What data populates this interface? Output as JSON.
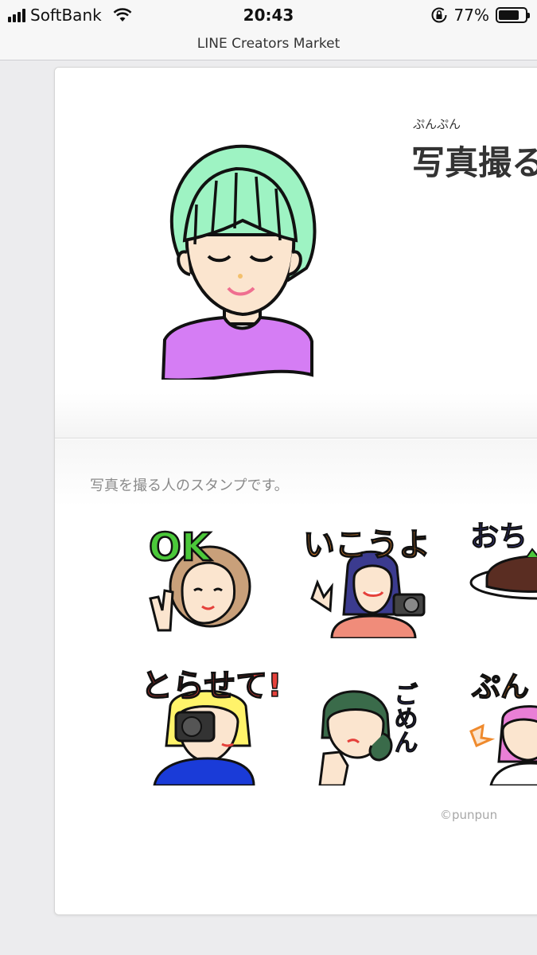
{
  "status_bar": {
    "carrier": "SoftBank",
    "time": "20:43",
    "battery_percent": "77%",
    "battery_level": 0.77
  },
  "browser": {
    "page_title": "LINE Creators Market"
  },
  "product": {
    "author": "ぷんぷん",
    "title": "写真撮る",
    "description": "写真を撮る人のスタンプです。",
    "copyright": "©punpun"
  },
  "stickers": {
    "s1": "OK",
    "s2": "いこうよ",
    "s3": "おち",
    "s4": "とらせて!",
    "s5": "ごめん",
    "s6": "ぷん"
  },
  "colors": {
    "hair_mint": "#9ef3c3",
    "shirt_purple": "#d57df4",
    "skin": "#fbe5cf",
    "text_orange": "#ef8a2d",
    "text_red": "#e5413b",
    "text_green": "#4bc83a",
    "text_navy": "#3b3b8f"
  }
}
